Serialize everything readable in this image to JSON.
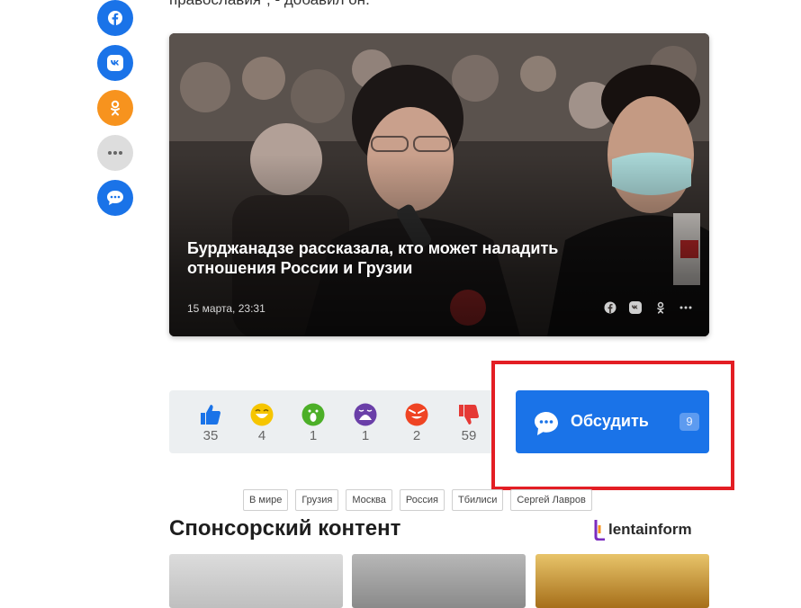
{
  "article": {
    "tail_text": "православия\", - добавил он."
  },
  "share_bar": [
    {
      "name": "facebook",
      "icon": "facebook-icon",
      "color": "#1a73e8"
    },
    {
      "name": "vk",
      "icon": "vk-icon",
      "color": "#1a73e8"
    },
    {
      "name": "ok",
      "icon": "odnoklassniki-icon",
      "color": "#f7931e"
    },
    {
      "name": "more",
      "icon": "more-dots-icon",
      "color": "#dddddd"
    },
    {
      "name": "comments",
      "icon": "chat-bubble-icon",
      "color": "#1a73e8"
    }
  ],
  "related_card": {
    "title": "Бурджанадзе рассказала, кто может наладить отношения России и Грузии",
    "date": "15 марта, 23:31",
    "share_icons": [
      "facebook-icon",
      "vk-icon",
      "odnoklassniki-icon",
      "more-dots-icon"
    ]
  },
  "reactions": [
    {
      "name": "like",
      "icon": "thumbs-up-icon",
      "count": "35"
    },
    {
      "name": "laugh",
      "icon": "laughing-emoji-icon",
      "count": "4"
    },
    {
      "name": "wow",
      "icon": "surprised-emoji-icon",
      "count": "1"
    },
    {
      "name": "sad",
      "icon": "sad-emoji-icon",
      "count": "1"
    },
    {
      "name": "angry",
      "icon": "angry-emoji-icon",
      "count": "2"
    },
    {
      "name": "dislike",
      "icon": "thumbs-down-icon",
      "count": "59"
    }
  ],
  "discuss": {
    "label": "Обсудить",
    "count": "9",
    "color": "#1a73e8"
  },
  "tags": [
    "В мире",
    "Грузия",
    "Москва",
    "Россия",
    "Тбилиси",
    "Сергей Лавров"
  ],
  "sponsored": {
    "title": "Спонсорский контент",
    "brand": "lentainform"
  },
  "colors": {
    "accent": "#1a73e8",
    "highlight": "#e31e24",
    "ok_orange": "#f7931e"
  }
}
